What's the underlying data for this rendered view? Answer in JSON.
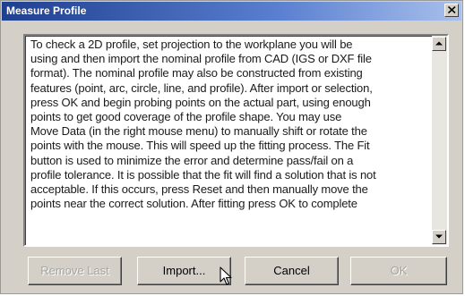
{
  "dialog": {
    "title": "Measure Profile",
    "close_label": "×"
  },
  "message": {
    "lines": [
      "To check a 2D profile, set projection to the workplane you will be",
      "using and then import the nominal profile from CAD (IGS or DXF file",
      "format).  The nominal profile may also be constructed from existing",
      "features (point, arc, circle, line, and profile).  After import or selection,",
      "press OK and begin probing points on the actual part, using enough",
      "points to get good coverage of the profile shape. You may use",
      "Move Data (in the right mouse menu) to manually shift or rotate the",
      "points with the mouse.  This will speed up the fitting process.  The Fit",
      "button is used to minimize the error and determine pass/fail on a",
      "profile tolerance.  It is possible that the fit will find a solution that is not",
      "acceptable.  If this occurs, press Reset and then manually move the",
      "points near the correct solution. After fitting press OK to complete"
    ]
  },
  "buttons": {
    "remove_last": "Remove Last",
    "import": "Import...",
    "cancel": "Cancel",
    "ok": "OK"
  },
  "colors": {
    "titlebar_start": "#1f3f8f",
    "titlebar_end": "#a8c0ec",
    "dialog_face": "#d4d0c8",
    "disabled_text": "#a6a49e"
  },
  "icons": {
    "close": "close-icon",
    "scroll_up": "arrow-up-icon",
    "scroll_down": "arrow-down-icon",
    "cursor": "mouse-pointer-icon"
  }
}
